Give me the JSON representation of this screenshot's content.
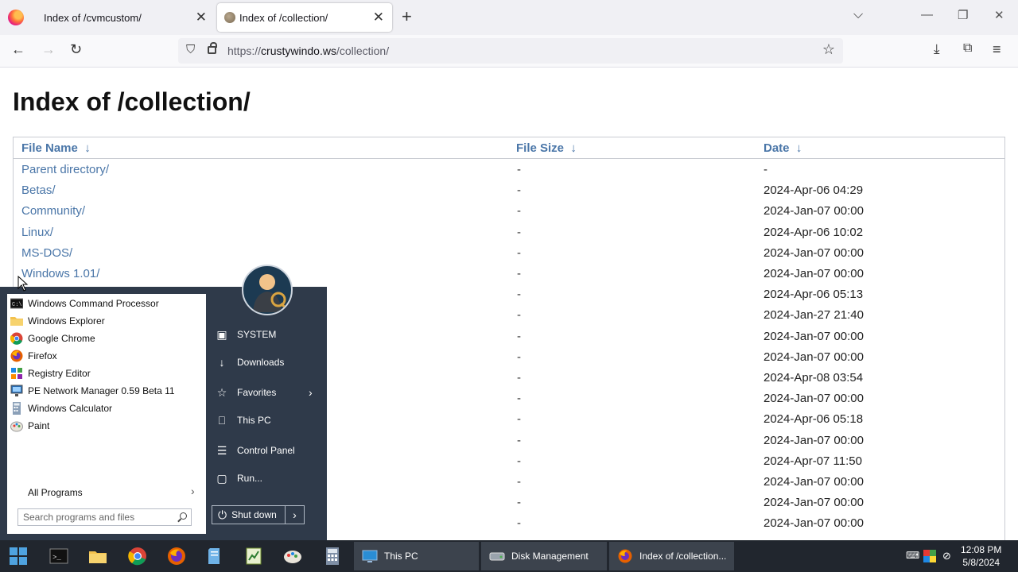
{
  "browser": {
    "tabs": [
      {
        "title": "Index of /cvmcustom/",
        "active": false
      },
      {
        "title": "Index of /collection/",
        "active": true
      }
    ],
    "url_prefix": "https://",
    "url_host": "crustywindo.ws",
    "url_path": "/collection/",
    "icons": [
      "firefox-icon",
      "back-icon",
      "forward-icon",
      "reload-icon",
      "shield-icon",
      "lock-icon",
      "star-icon",
      "download-icon",
      "extensions-icon",
      "menu-icon"
    ]
  },
  "page": {
    "title": "Index of /collection/",
    "columns": [
      {
        "label": "File Name",
        "sort": "↓"
      },
      {
        "label": "File Size",
        "sort": "↓"
      },
      {
        "label": "Date",
        "sort": "↓"
      }
    ],
    "rows": [
      {
        "name": "Parent directory/",
        "size": "-",
        "date": "-"
      },
      {
        "name": "Betas/",
        "size": "-",
        "date": "2024-Apr-06 04:29"
      },
      {
        "name": "Community/",
        "size": "-",
        "date": "2024-Jan-07 00:00"
      },
      {
        "name": "Linux/",
        "size": "-",
        "date": "2024-Apr-06 10:02"
      },
      {
        "name": "MS-DOS/",
        "size": "-",
        "date": "2024-Jan-07 00:00"
      },
      {
        "name": "Windows 1.01/",
        "size": "-",
        "date": "2024-Jan-07 00:00"
      },
      {
        "name": "",
        "size": "-",
        "date": "2024-Apr-06 05:13"
      },
      {
        "name": "",
        "size": "-",
        "date": "2024-Jan-27 21:40"
      },
      {
        "name": "",
        "size": "-",
        "date": "2024-Jan-07 00:00"
      },
      {
        "name": "",
        "size": "-",
        "date": "2024-Jan-07 00:00"
      },
      {
        "name": "",
        "size": "-",
        "date": "2024-Apr-08 03:54"
      },
      {
        "name": "",
        "size": "-",
        "date": "2024-Jan-07 00:00"
      },
      {
        "name": "",
        "size": "-",
        "date": "2024-Apr-06 05:18"
      },
      {
        "name": "",
        "size": "-",
        "date": "2024-Jan-07 00:00"
      },
      {
        "name": "",
        "size": "-",
        "date": "2024-Apr-07 11:50"
      },
      {
        "name": "",
        "size": "-",
        "date": "2024-Jan-07 00:00"
      },
      {
        "name": "",
        "size": "-",
        "date": "2024-Jan-07 00:00"
      },
      {
        "name": "",
        "size": "-",
        "date": "2024-Jan-07 00:00"
      }
    ]
  },
  "start_menu": {
    "programs": [
      {
        "label": "Windows Command Processor",
        "icon": "cmd-icon"
      },
      {
        "label": "Windows Explorer",
        "icon": "folder-icon"
      },
      {
        "label": "Google Chrome",
        "icon": "chrome-icon"
      },
      {
        "label": "Firefox",
        "icon": "firefox-icon"
      },
      {
        "label": "Registry Editor",
        "icon": "registry-icon"
      },
      {
        "label": "PE Network Manager 0.59 Beta 11",
        "icon": "network-icon"
      },
      {
        "label": "Windows Calculator",
        "icon": "calculator-icon"
      },
      {
        "label": "Paint",
        "icon": "paint-icon"
      }
    ],
    "all_programs": "All Programs",
    "search_placeholder": "Search programs and files",
    "right_items": [
      {
        "label": "SYSTEM",
        "icon": "user-folder-icon"
      },
      {
        "label": "Downloads",
        "icon": "download-icon"
      },
      {
        "label": "Favorites",
        "icon": "star-icon"
      },
      {
        "label": "This PC",
        "icon": "computer-icon"
      },
      {
        "label": "Control Panel",
        "icon": "control-panel-icon"
      },
      {
        "label": "Run...",
        "icon": "run-icon"
      }
    ],
    "shutdown": "Shut down"
  },
  "taskbar": {
    "windows": [
      {
        "label": "This PC",
        "icon": "computer-icon"
      },
      {
        "label": "Disk Management",
        "icon": "disk-icon"
      },
      {
        "label": "Index of /collection...",
        "icon": "firefox-icon"
      }
    ],
    "time": "12:08 PM",
    "date": "5/8/2024"
  },
  "colors": {
    "link": "#4a76a8",
    "menu_bg": "#2f3a4a",
    "taskbar_bg": "#21262e"
  }
}
